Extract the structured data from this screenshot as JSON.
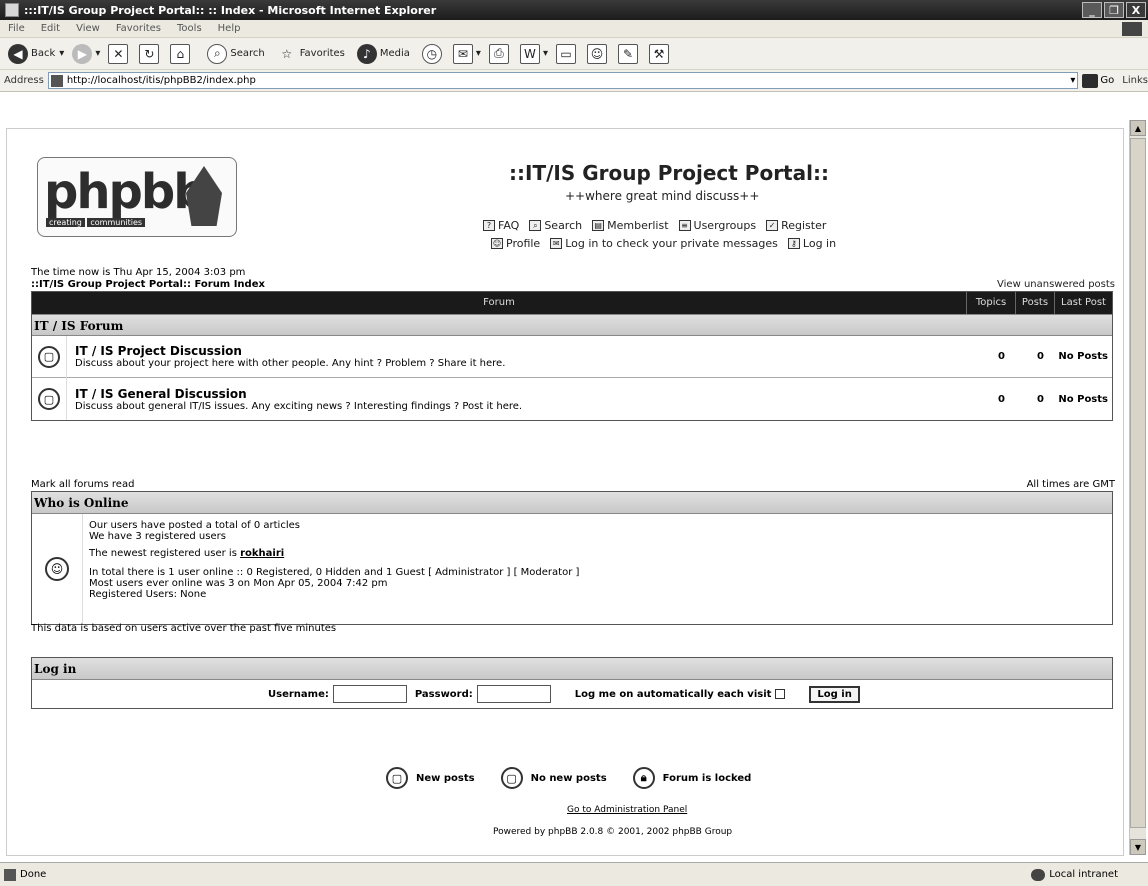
{
  "window": {
    "title": ":::IT/IS Group Project Portal:: :: Index - Microsoft Internet Explorer",
    "minimize": "_",
    "maximize": "❐",
    "close": "X"
  },
  "menu": [
    "File",
    "Edit",
    "View",
    "Favorites",
    "Tools",
    "Help"
  ],
  "toolbar": {
    "back": "Back",
    "search": "Search",
    "favorites": "Favorites",
    "media": "Media"
  },
  "address": {
    "label": "Address",
    "url": "http://localhost/itis/phpBB2/index.php",
    "go": "Go",
    "links": "Links"
  },
  "site": {
    "logo_text": "phpbb",
    "logo_tag": "creating",
    "logo_tag2": "communities",
    "title": "::IT/IS Group Project Portal::",
    "description": "++where great mind discuss++",
    "nav1": [
      "FAQ",
      "Search",
      "Memberlist",
      "Usergroups",
      "Register"
    ],
    "nav2": [
      "Profile",
      "Log in to check your private messages",
      "Log in"
    ]
  },
  "time_now": "The time now is Thu Apr 15, 2004 3:03 pm",
  "breadcrumb": "::IT/IS Group Project Portal:: Forum Index",
  "view_unanswered": "View unanswered posts",
  "forum_table": {
    "headers": [
      "Forum",
      "Topics",
      "Posts",
      "Last Post"
    ],
    "category": "IT / IS Forum",
    "rows": [
      {
        "name": "IT / IS Project Discussion",
        "description": "Discuss about your project here with other people. Any hint ? Problem ? Share it here.",
        "topics": "0",
        "posts": "0",
        "last": "No Posts"
      },
      {
        "name": "IT / IS General Discussion",
        "description": "Discuss about general IT/IS issues. Any exciting news ? Interesting findings ? Post it here.",
        "topics": "0",
        "posts": "0",
        "last": "No Posts"
      }
    ]
  },
  "mark_read": "Mark all forums read",
  "timezone": "All times are GMT",
  "who_online": {
    "title": "Who is Online",
    "line1": "Our users have posted a total of 0 articles",
    "line2": "We have 3 registered users",
    "line3_prefix": "The newest registered user is ",
    "line3_user": "rokhairi",
    "line4": "In total there is 1 user online :: 0 Registered, 0 Hidden and 1 Guest   [ Administrator ]   [ Moderator ]",
    "line5": "Most users ever online was 3 on Mon Apr 05, 2004 7:42 pm",
    "line6": "Registered Users: None"
  },
  "based_on": "This data is based on users active over the past five minutes",
  "login": {
    "title": "Log in",
    "username_label": "Username:",
    "password_label": "Password:",
    "auto_label": "Log me on automatically each visit",
    "button": "Log in"
  },
  "legend": [
    "New posts",
    "No new posts",
    "Forum is locked"
  ],
  "admin_link": "Go to Administration Panel",
  "powered_by": "Powered by phpBB 2.0.8 © 2001, 2002 phpBB Group",
  "status": {
    "done": "Done",
    "zone": "Local intranet"
  }
}
